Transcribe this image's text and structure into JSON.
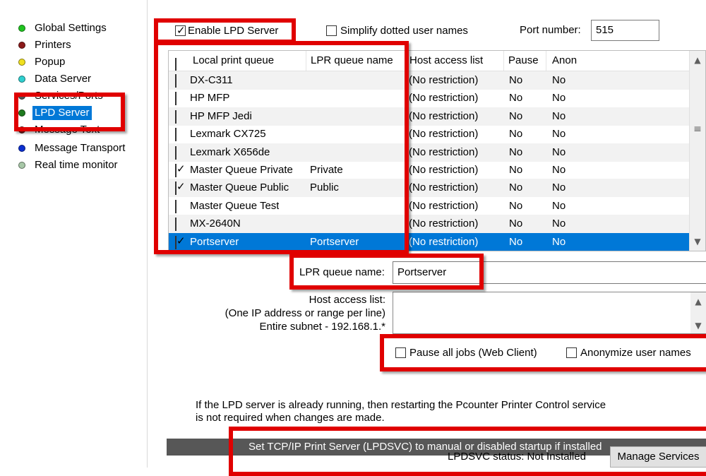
{
  "nav": {
    "items": [
      {
        "label": "Global Settings",
        "color": "#1fc41f"
      },
      {
        "label": "Printers",
        "color": "#8b1a1a"
      },
      {
        "label": "Popup",
        "color": "#f0e020"
      },
      {
        "label": "Data Server",
        "color": "#2ed0d0"
      },
      {
        "label": "Services/Ports",
        "color": "#555555"
      },
      {
        "label": "LPD Server",
        "color": "#1e7a1e"
      },
      {
        "label": "Message Text",
        "color": "#8b1a1a"
      },
      {
        "label": "Message Transport",
        "color": "#0b2fd0"
      },
      {
        "label": "Real time monitor",
        "color": "#a8c8a8"
      }
    ],
    "selected_index": 5
  },
  "top": {
    "enable_lpd_label": "Enable LPD Server",
    "enable_lpd_checked": true,
    "simplify_label": "Simplify dotted user names",
    "simplify_checked": false,
    "port_label": "Port number:",
    "port_value": "515"
  },
  "table": {
    "headers": [
      "Local print queue",
      "LPR queue name",
      "Host access list",
      "Pause",
      "Anon"
    ],
    "rows": [
      {
        "checked": false,
        "local": "DX-C311",
        "lpr": "",
        "host": "(No restriction)",
        "pause": "No",
        "anon": "No"
      },
      {
        "checked": false,
        "local": "HP MFP",
        "lpr": "",
        "host": "(No restriction)",
        "pause": "No",
        "anon": "No"
      },
      {
        "checked": false,
        "local": "HP MFP Jedi",
        "lpr": "",
        "host": "(No restriction)",
        "pause": "No",
        "anon": "No"
      },
      {
        "checked": false,
        "local": "Lexmark CX725",
        "lpr": "",
        "host": "(No restriction)",
        "pause": "No",
        "anon": "No"
      },
      {
        "checked": false,
        "local": "Lexmark X656de",
        "lpr": "",
        "host": "(No restriction)",
        "pause": "No",
        "anon": "No"
      },
      {
        "checked": true,
        "local": "Master Queue Private",
        "lpr": "Private",
        "host": "(No restriction)",
        "pause": "No",
        "anon": "No"
      },
      {
        "checked": true,
        "local": "Master Queue Public",
        "lpr": "Public",
        "host": "(No restriction)",
        "pause": "No",
        "anon": "No"
      },
      {
        "checked": false,
        "local": "Master Queue Test",
        "lpr": "",
        "host": "(No restriction)",
        "pause": "No",
        "anon": "No"
      },
      {
        "checked": false,
        "local": "MX-2640N",
        "lpr": "",
        "host": "(No restriction)",
        "pause": "No",
        "anon": "No"
      },
      {
        "checked": true,
        "local": "Portserver",
        "lpr": "Portserver",
        "host": "(No restriction)",
        "pause": "No",
        "anon": "No"
      }
    ],
    "selected_row": 9,
    "scroll_up_icon": "▲",
    "scroll_down_icon": "▼",
    "scroll_grip_icon": "≡"
  },
  "detail": {
    "lpr_name_label": "LPR queue name:",
    "lpr_name_value": "Portserver",
    "host_access_label": "Host access list:",
    "host_access_hint1": "(One IP address or range per line)",
    "host_access_hint2": "Entire subnet - 192.168.1.*",
    "pause_label": "Pause all jobs (Web Client)",
    "anon_label": "Anonymize user names",
    "info_line1": "If the LPD server is already running, then restarting the Pcounter Printer Control service",
    "info_line2": "is not required when changes are made."
  },
  "lpdsvc": {
    "banner": "Set TCP/IP Print Server (LPDSVC) to manual or disabled startup if installed",
    "status_label": "LPDSVC status: Not Installed",
    "manage_button": "Manage Services"
  }
}
